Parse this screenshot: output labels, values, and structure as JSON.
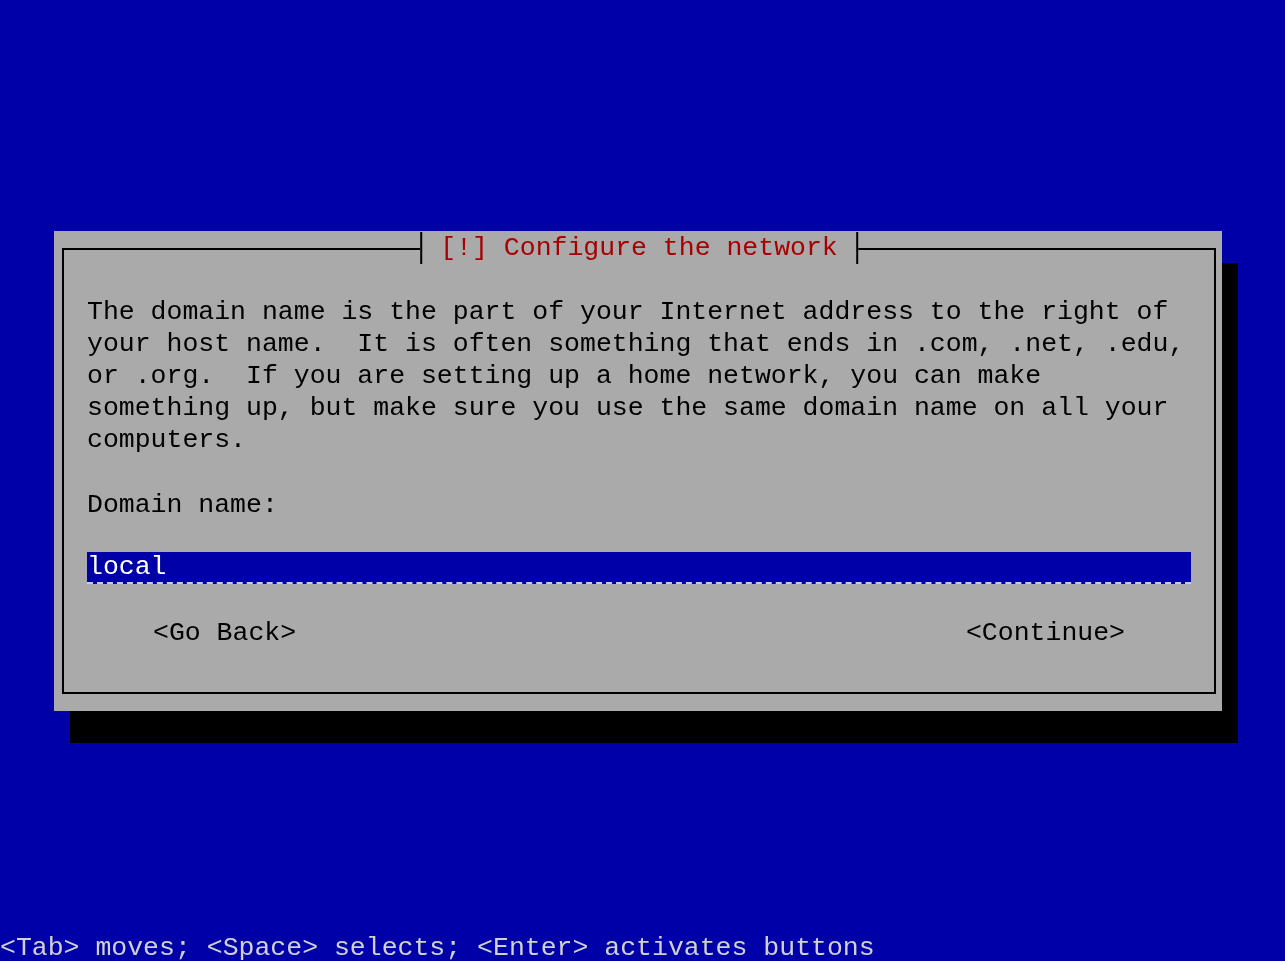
{
  "dialog": {
    "title": "[!] Configure the network",
    "message": "The domain name is the part of your Internet address to the right of\nyour host name.  It is often something that ends in .com, .net, .edu,\nor .org.  If you are setting up a home network, you can make\nsomething up, but make sure you use the same domain name on all your\ncomputers.",
    "field": {
      "label": "Domain name:",
      "value": "local"
    },
    "buttons": [
      {
        "label": "<Go Back>"
      },
      {
        "label": "<Continue>"
      }
    ]
  },
  "status_bar": "<Tab> moves; <Space> selects; <Enter> activates buttons"
}
